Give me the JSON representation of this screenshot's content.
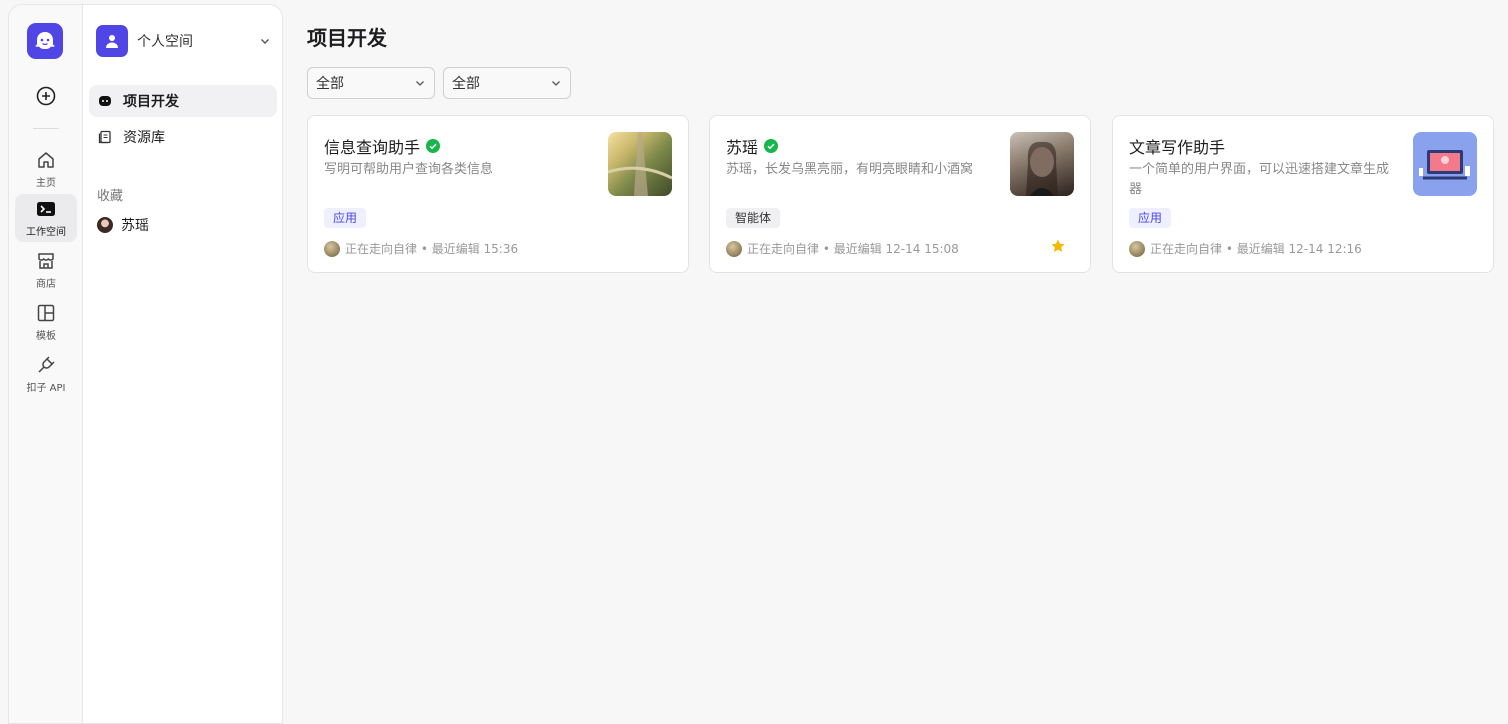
{
  "rail": {
    "items": [
      {
        "label": "主页"
      },
      {
        "label": "工作空间"
      },
      {
        "label": "商店"
      },
      {
        "label": "模板"
      },
      {
        "label": "扣子 API"
      }
    ]
  },
  "sidebar": {
    "space_name": "个人空间",
    "items": [
      {
        "label": "项目开发"
      },
      {
        "label": "资源库"
      }
    ],
    "favorites_label": "收藏",
    "favorites": [
      {
        "label": "苏瑶"
      }
    ]
  },
  "main": {
    "title": "项目开发",
    "filters": [
      {
        "value": "全部"
      },
      {
        "value": "全部"
      }
    ],
    "cards": [
      {
        "title": "信息查询助手",
        "description": "写明可帮助用户查询各类信息",
        "tag": "应用",
        "meta": "正在走向自律 • 最近编辑 15:36"
      },
      {
        "title": "苏瑶",
        "description": "苏瑶，长发乌黑亮丽，有明亮眼睛和小酒窝",
        "tag": "智能体",
        "meta": "正在走向自律 • 最近编辑 12-14 15:08"
      },
      {
        "title": "文章写作助手",
        "description": "一个简单的用户界面，可以迅速搭建文章生成器",
        "tag": "应用",
        "meta": "正在走向自律 • 最近编辑 12-14 12:16"
      }
    ]
  },
  "colors": {
    "brand": "#4f46e5",
    "verified": "#15b64a",
    "star": "#f5b800"
  }
}
